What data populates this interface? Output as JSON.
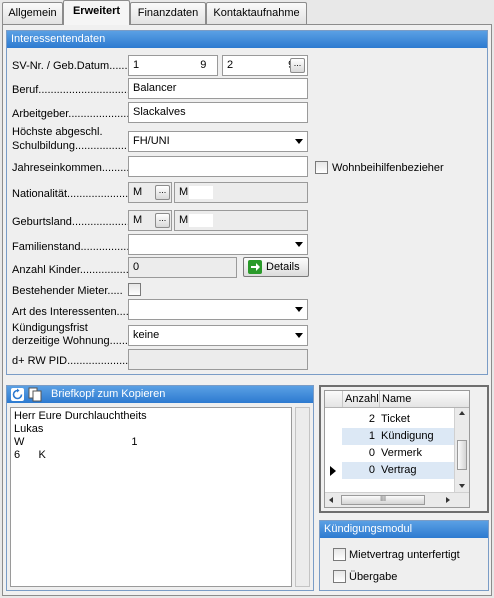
{
  "tabs": [
    "Allgemein",
    "Erweitert",
    "Finanzdaten",
    "Kontaktaufnahme"
  ],
  "interessenten": {
    "title": "Interessentendaten",
    "sv_label": "SV-Nr. / Geb.Datum.......",
    "sv_nr": "1                    9",
    "geb_datum": "2                  9",
    "beruf_label": "Beruf..............................",
    "beruf": "Balancer",
    "arbeitgeber_label": "Arbeitgeber......................",
    "arbeitgeber": "Slackalves",
    "schul_label1": "Höchste abgeschl.",
    "schul_label2": "Schulbildung.....................",
    "schulbildung": "FH/UNI",
    "jahres_label": "Jahreseinkommen.............",
    "jahreseinkommen": "",
    "wohnbeihilfe_label": "Wohnbeihilfenbezieher",
    "nat_label": "Nationalität......................",
    "nat_code": "M",
    "nat_name": "M",
    "geburtsland_label": "Geburtsland......................",
    "geb_code": "M",
    "geb_name": "M",
    "familienstand_label": "Familienstand...................",
    "familienstand": "",
    "kinder_label": "Anzahl Kinder...................",
    "kinder": "0",
    "details_label": "Details",
    "mieter_label": "Bestehender Mieter.....",
    "art_label": "Art des Interessenten.....",
    "art": "",
    "kuend_label1": "Kündigungsfrist",
    "kuend_label2": "derzeitige Wohnung.......",
    "kuendigungsfrist": "keine",
    "rwpid_label": "d+ RW PID......................",
    "rwpid": "",
    "dots": "..."
  },
  "briefkopf": {
    "title": "Briefkopf zum Kopieren",
    "lines": [
      "Herr Eure Durchlauchtheits",
      "Lukas",
      "W                                   1",
      "6      K"
    ]
  },
  "grid": {
    "headers": [
      "Anzahl",
      "Name"
    ],
    "rows": [
      {
        "count": "2",
        "name": "Ticket"
      },
      {
        "count": "1",
        "name": "Kündigung"
      },
      {
        "count": "0",
        "name": "Vermerk"
      },
      {
        "count": "0",
        "name": "Vertrag"
      }
    ],
    "scroll_thumb": "III"
  },
  "kuendigungsmodul": {
    "title": "Kündigungsmodul",
    "items": [
      "Mietvertrag unterfertigt",
      "Übergabe"
    ]
  },
  "colors": {
    "header_top": "#5aa0e4",
    "header_bottom": "#2d7ad0",
    "selected_row": "#dce8f5",
    "details_icon": "#2a9a2a"
  }
}
